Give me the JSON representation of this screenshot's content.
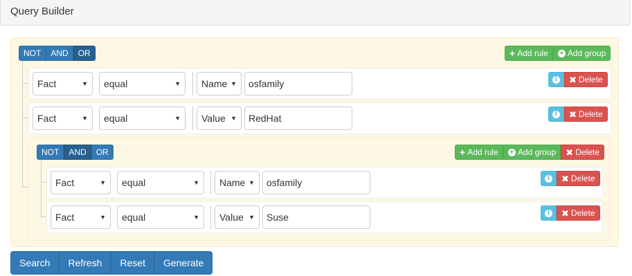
{
  "header": {
    "title": "Query Builder"
  },
  "root_group": {
    "conditions": [
      "NOT",
      "AND",
      "OR"
    ],
    "active_condition": "OR",
    "add_rule_label": "Add rule",
    "add_group_label": "Add group",
    "rules": [
      {
        "field": "Fact",
        "operator": "equal",
        "type": "Name",
        "value": "osfamily",
        "delete_label": "Delete"
      },
      {
        "field": "Fact",
        "operator": "equal",
        "type": "Value",
        "value": "RedHat",
        "delete_label": "Delete"
      }
    ],
    "subgroup": {
      "conditions": [
        "NOT",
        "AND",
        "OR"
      ],
      "active_condition": "AND",
      "add_rule_label": "Add rule",
      "add_group_label": "Add group",
      "delete_label": "Delete",
      "rules": [
        {
          "field": "Fact",
          "operator": "equal",
          "type": "Name",
          "value": "osfamily",
          "delete_label": "Delete"
        },
        {
          "field": "Fact",
          "operator": "equal",
          "type": "Value",
          "value": "Suse",
          "delete_label": "Delete"
        }
      ]
    }
  },
  "footer": {
    "search_label": "Search",
    "refresh_label": "Refresh",
    "reset_label": "Reset",
    "generate_label": "Generate"
  },
  "colors": {
    "primary": "#337ab7",
    "success": "#5cb85c",
    "danger": "#d9534f",
    "info": "#5bc0de",
    "group_bg": "#fcf8e3"
  }
}
